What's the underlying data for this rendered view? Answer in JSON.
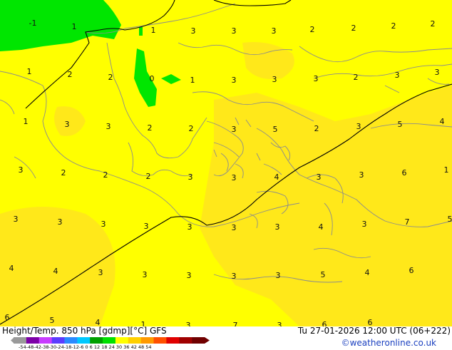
{
  "footer": {
    "product": "Height/Temp. 850 hPa [gdmp][°C] GFS",
    "valid_time": "Tu 27-01-2026 12:00 UTC (06+222)",
    "credit": "©weatheronline.co.uk",
    "scale_ticks": "-54-48-42-38-30-24-18-12-6  0  6  12 18 24 30 36 42 48 54"
  },
  "colors": {
    "field_yellow": "#ffff00",
    "field_warm": "#ffe81a",
    "field_green": "#00e600",
    "coast": "#8c8c8c",
    "contour": "#000000",
    "scale": [
      "#9a9a9a",
      "#7d00a8",
      "#c83cff",
      "#5b3cff",
      "#2a8aff",
      "#00c8ff",
      "#00a000",
      "#00e000",
      "#ffff00",
      "#ffd000",
      "#ff9a00",
      "#ff5000",
      "#e00000",
      "#a00000",
      "#700000"
    ]
  },
  "map_labels": [
    "-1",
    "1",
    "1",
    "3",
    "3",
    "3",
    "2",
    "2",
    "2",
    "2",
    "1",
    "2",
    "2",
    "0",
    "1",
    "3",
    "3",
    "3",
    "2",
    "3",
    "3",
    "1",
    "3",
    "3",
    "2",
    "2",
    "3",
    "5",
    "2",
    "3",
    "5",
    "4",
    "3",
    "2",
    "2",
    "2",
    "3",
    "3",
    "4",
    "3",
    "3",
    "6",
    "1",
    "3",
    "3",
    "3",
    "3",
    "3",
    "3",
    "3",
    "4",
    "3",
    "7",
    "5",
    "4",
    "4",
    "3",
    "3",
    "3",
    "3",
    "3",
    "5",
    "4",
    "6",
    "6",
    "5",
    "4",
    "1",
    "3",
    "7",
    "3",
    "6",
    "6"
  ]
}
